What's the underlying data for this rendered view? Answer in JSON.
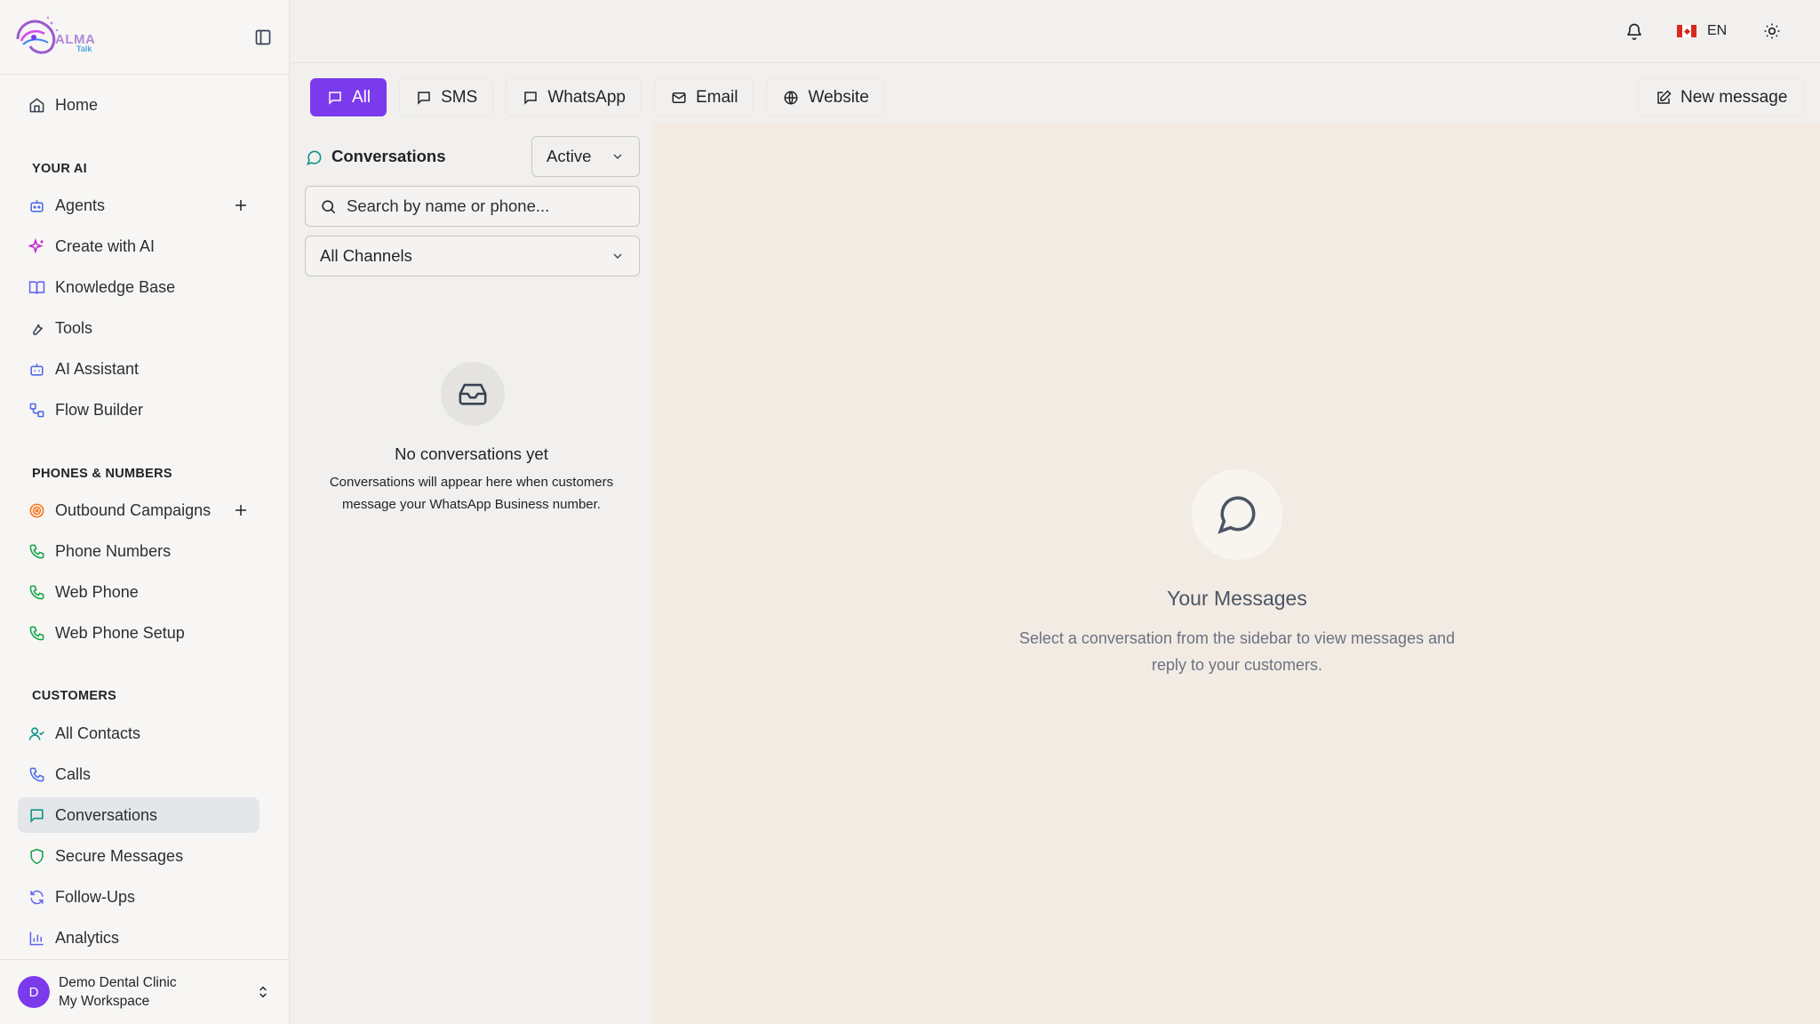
{
  "app": {
    "brand": "ALMA",
    "brand_sub": "Talk"
  },
  "sidebar": {
    "home": "Home",
    "sections": {
      "your_ai": "YOUR AI",
      "phones": "PHONES & NUMBERS",
      "customers": "CUSTOMERS"
    },
    "items": [
      {
        "label": "Agents",
        "icon": "robot-icon",
        "color": "#4f6bed"
      },
      {
        "label": "Create with AI",
        "icon": "sparkles-icon",
        "color": "#c026d3"
      },
      {
        "label": "Knowledge Base",
        "icon": "book-icon",
        "color": "#6366f1"
      },
      {
        "label": "Tools",
        "icon": "wrench-icon",
        "color": "#374151"
      },
      {
        "label": "AI Assistant",
        "icon": "bot-icon",
        "color": "#4f6bed"
      },
      {
        "label": "Flow Builder",
        "icon": "workflow-icon",
        "color": "#4f6bed"
      },
      {
        "label": "Outbound Campaigns",
        "icon": "target-icon",
        "color": "#f97316"
      },
      {
        "label": "Phone Numbers",
        "icon": "phone-icon",
        "color": "#16a34a"
      },
      {
        "label": "Web Phone",
        "icon": "phone-icon",
        "color": "#16a34a"
      },
      {
        "label": "Web Phone Setup",
        "icon": "phone-icon",
        "color": "#16a34a"
      },
      {
        "label": "All Contacts",
        "icon": "user-check-icon",
        "color": "#0d9488"
      },
      {
        "label": "Calls",
        "icon": "phone-icon",
        "color": "#4f6bed"
      },
      {
        "label": "Conversations",
        "icon": "message-square-icon",
        "color": "#0d9488"
      },
      {
        "label": "Secure Messages",
        "icon": "shield-icon",
        "color": "#16a34a"
      },
      {
        "label": "Follow-Ups",
        "icon": "refresh-icon",
        "color": "#6366f1"
      },
      {
        "label": "Analytics",
        "icon": "bar-chart-icon",
        "color": "#6366f1"
      }
    ],
    "user": {
      "initial": "D",
      "name": "Demo Dental Clinic",
      "workspace": "My Workspace"
    }
  },
  "topbar": {
    "language": "EN"
  },
  "tabs": [
    {
      "label": "All",
      "active": true
    },
    {
      "label": "SMS",
      "active": false
    },
    {
      "label": "WhatsApp",
      "active": false
    },
    {
      "label": "Email",
      "active": false
    },
    {
      "label": "Website",
      "active": false
    }
  ],
  "new_message_label": "New message",
  "conversations": {
    "title": "Conversations",
    "status_value": "Active",
    "search_placeholder": "Search by name or phone...",
    "channel_value": "All Channels",
    "empty_title": "No conversations yet",
    "empty_desc": "Conversations will appear here when customers message your WhatsApp Business number."
  },
  "messages": {
    "title": "Your Messages",
    "desc": "Select a conversation from the sidebar to view messages and reply to your customers."
  },
  "colors": {
    "accent": "#7c3aed"
  }
}
